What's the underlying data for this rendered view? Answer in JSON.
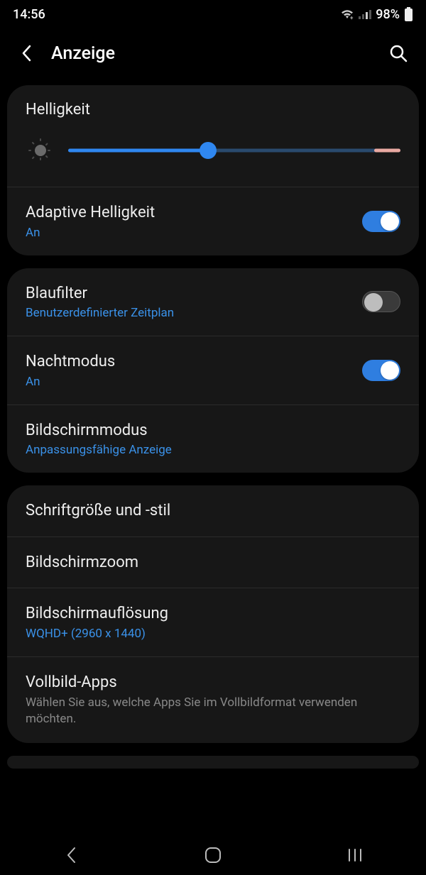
{
  "status": {
    "time": "14:56",
    "battery": "98%"
  },
  "header": {
    "title": "Anzeige"
  },
  "brightness": {
    "title": "Helligkeit",
    "value_pct": 42,
    "warn_from_pct": 92
  },
  "items": {
    "adaptive": {
      "label": "Adaptive Helligkeit",
      "sub": "An",
      "on": true
    },
    "bluefilter": {
      "label": "Blaufilter",
      "sub": "Benutzerdefinierter Zeitplan",
      "on": false
    },
    "nightmode": {
      "label": "Nachtmodus",
      "sub": "An",
      "on": true
    },
    "screenmode": {
      "label": "Bildschirmmodus",
      "sub": "Anpassungsfähige Anzeige"
    },
    "font": {
      "label": "Schriftgröße und -stil"
    },
    "zoom": {
      "label": "Bildschirmzoom"
    },
    "resolution": {
      "label": "Bildschirmauflösung",
      "sub": "WQHD+ (2960 x 1440)"
    },
    "fullscreen": {
      "label": "Vollbild-Apps",
      "desc": "Wählen Sie aus, welche Apps Sie im Vollbildformat verwenden möchten."
    }
  }
}
